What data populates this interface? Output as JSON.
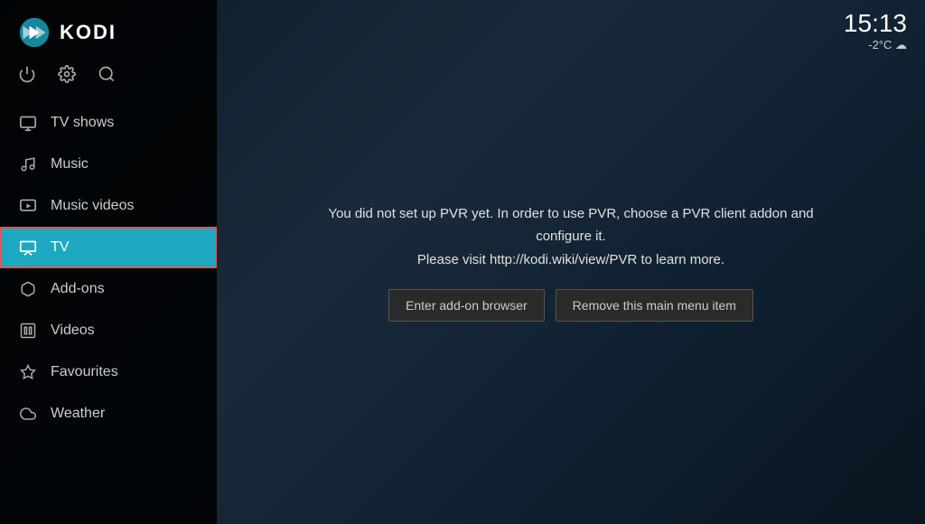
{
  "app": {
    "name": "KODI"
  },
  "clock": {
    "time": "15:13",
    "weather": "-2°C ☁"
  },
  "toolbar": {
    "power_icon": "⏻",
    "settings_icon": "⚙",
    "search_icon": "🔍"
  },
  "sidebar": {
    "items": [
      {
        "id": "tv-shows",
        "label": "TV shows",
        "icon": "tv-shows-icon",
        "active": false
      },
      {
        "id": "music",
        "label": "Music",
        "icon": "music-icon",
        "active": false
      },
      {
        "id": "music-videos",
        "label": "Music videos",
        "icon": "music-videos-icon",
        "active": false
      },
      {
        "id": "tv",
        "label": "TV",
        "icon": "tv-icon",
        "active": true
      },
      {
        "id": "add-ons",
        "label": "Add-ons",
        "icon": "addons-icon",
        "active": false
      },
      {
        "id": "videos",
        "label": "Videos",
        "icon": "videos-icon",
        "active": false
      },
      {
        "id": "favourites",
        "label": "Favourites",
        "icon": "favourites-icon",
        "active": false
      },
      {
        "id": "weather",
        "label": "Weather",
        "icon": "weather-icon",
        "active": false
      }
    ]
  },
  "main": {
    "pvr_message": "You did not set up PVR yet. In order to use PVR, choose a PVR client addon and configure it.\nPlease visit http://kodi.wiki/view/PVR to learn more.",
    "button_enter_addon": "Enter add-on browser",
    "button_remove_menu": "Remove this main menu item"
  }
}
